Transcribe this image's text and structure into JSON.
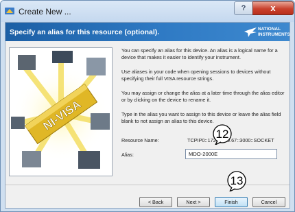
{
  "window": {
    "title": "Create New ...",
    "help_label": "?",
    "close_label": "x"
  },
  "header": {
    "title": "Specify an alias for this resource (optional).",
    "brand_line1": "NATIONAL",
    "brand_line2": "INSTRUMENTS"
  },
  "illustration": {
    "label": "NI-VISA"
  },
  "paragraphs": {
    "p1": "You can specify an alias for this device. An alias is a logical name for a device that makes it easier to identify your instrument.",
    "p2": "Use aliases in your code when opening sessions to devices without specifying their full VISA resource strings.",
    "p3": "You may assign or change the alias at a later time through the alias editor or by clicking on the device to rename it.",
    "p4": "Type in the alias you want to assign to this device or leave the alias field blank to not assign an alias to this device."
  },
  "resource": {
    "label": "Resource Name:",
    "value": "TCPIP0::172.16.20.67::3000::SOCKET"
  },
  "alias": {
    "label": "Alias:",
    "value": "MDO-2000E"
  },
  "buttons": {
    "back": "< Back",
    "next": "Next >",
    "finish": "Finish",
    "cancel": "Cancel"
  },
  "callouts": {
    "c12": "12",
    "c13": "13"
  },
  "colors": {
    "header": "#1c5fa5",
    "close": "#c9412d"
  }
}
